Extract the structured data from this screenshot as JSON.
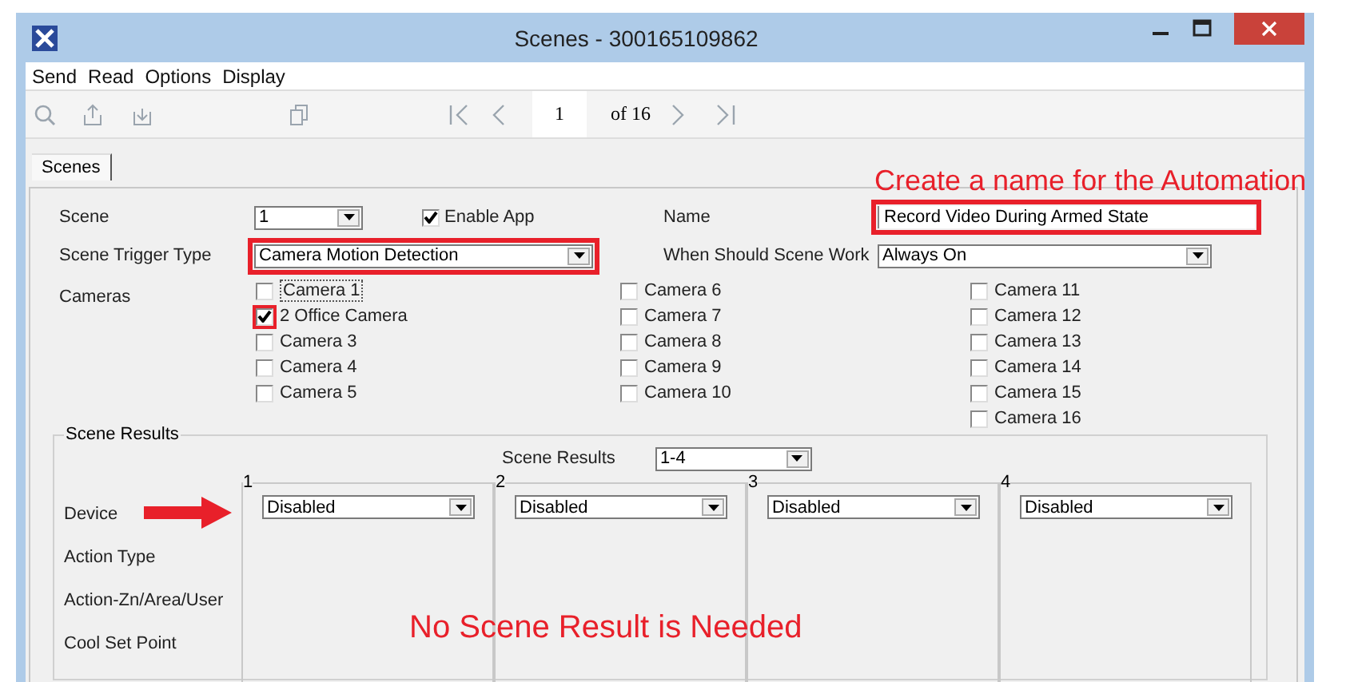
{
  "window": {
    "title": "Scenes - 300165109862"
  },
  "menu": [
    "Send",
    "Read",
    "Options",
    "Display"
  ],
  "toolbar": {
    "page": "1",
    "page_count": "of 16"
  },
  "tabs": [
    {
      "label": "Scenes",
      "selected": true
    }
  ],
  "note": "Create a name for the Automation",
  "form": {
    "scene": {
      "label": "Scene",
      "value": "1",
      "highlighted": false
    },
    "enable_app": {
      "label": "Enable App",
      "checked": true
    },
    "name": {
      "label": "Name",
      "value": "Record Video During Armed State",
      "highlighted": true
    },
    "trigger": {
      "label": "Scene Trigger Type",
      "value": "Camera Motion Detection",
      "highlighted": true
    },
    "when": {
      "label": "When Should Scene Work",
      "value": "Always On",
      "highlighted": false
    },
    "cameras_label": "Cameras"
  },
  "cameras": [
    [
      {
        "label": "Camera 1",
        "checked": false,
        "focused": true,
        "highlighted": false
      },
      {
        "label": "2 Office Camera",
        "checked": true,
        "focused": false,
        "highlighted": true
      },
      {
        "label": "Camera 3",
        "checked": false,
        "focused": false,
        "highlighted": false
      },
      {
        "label": "Camera 4",
        "checked": false,
        "focused": false,
        "highlighted": false
      },
      {
        "label": "Camera 5",
        "checked": false,
        "focused": false,
        "highlighted": false
      }
    ],
    [
      {
        "label": "Camera 6",
        "checked": false,
        "focused": false,
        "highlighted": false
      },
      {
        "label": "Camera 7",
        "checked": false,
        "focused": false,
        "highlighted": false
      },
      {
        "label": "Camera 8",
        "checked": false,
        "focused": false,
        "highlighted": false
      },
      {
        "label": "Camera 9",
        "checked": false,
        "focused": false,
        "highlighted": false
      },
      {
        "label": "Camera 10",
        "checked": false,
        "focused": false,
        "highlighted": false
      }
    ],
    [
      {
        "label": "Camera 11",
        "checked": false,
        "focused": false,
        "highlighted": false
      },
      {
        "label": "Camera 12",
        "checked": false,
        "focused": false,
        "highlighted": false
      },
      {
        "label": "Camera 13",
        "checked": false,
        "focused": false,
        "highlighted": false
      },
      {
        "label": "Camera 14",
        "checked": false,
        "focused": false,
        "highlighted": false
      },
      {
        "label": "Camera 15",
        "checked": false,
        "focused": false,
        "highlighted": false
      },
      {
        "label": "Camera 16",
        "checked": false,
        "focused": false,
        "highlighted": false
      }
    ]
  ],
  "scene_results": {
    "title": "Scene Results",
    "selector": {
      "label": "Scene Results",
      "value": "1-4"
    },
    "rows": [
      {
        "label": "Device",
        "pointer": true
      },
      {
        "label": "Action Type",
        "pointer": false
      },
      {
        "label": "Action-Zn/Area/User",
        "pointer": false
      },
      {
        "label": "Cool Set Point",
        "pointer": false
      }
    ],
    "columns": [
      {
        "number": "1",
        "device": "Disabled"
      },
      {
        "number": "2",
        "device": "Disabled"
      },
      {
        "number": "3",
        "device": "Disabled"
      },
      {
        "number": "4",
        "device": "Disabled"
      }
    ],
    "note": "No Scene Result is Needed"
  }
}
